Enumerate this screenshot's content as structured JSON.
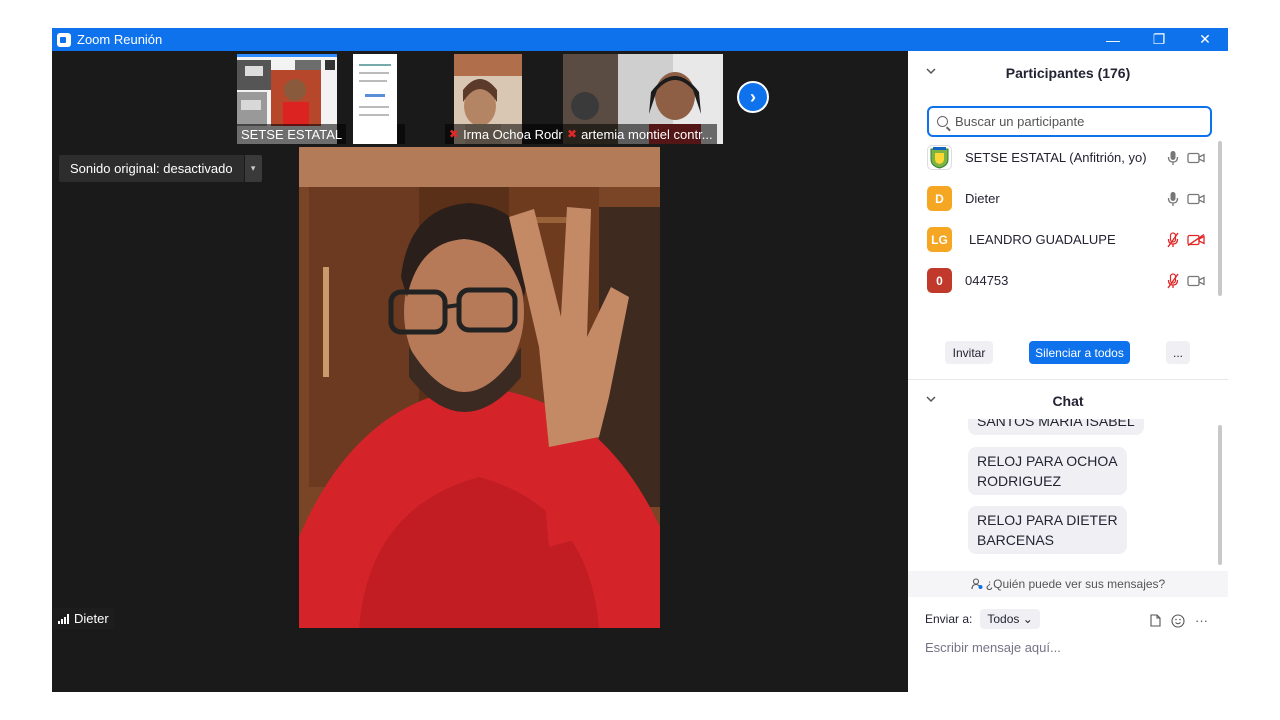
{
  "window": {
    "title": "Zoom Reunión",
    "controls": {
      "minimize": "—",
      "restore": "❐",
      "close": "✕"
    }
  },
  "video": {
    "thumbnails": [
      {
        "name": "SETSE ESTATAL",
        "muted": false
      },
      {
        "name": "",
        "muted": false
      },
      {
        "name": "Irma Ochoa Rodríguez",
        "muted": true
      },
      {
        "name": "artemia montiel contr...",
        "muted": true
      }
    ],
    "next_label": "›",
    "sound_label": "Sonido original: desactivado",
    "sound_caret": "▾",
    "active_speaker": "Dieter"
  },
  "participants": {
    "title": "Participantes (176)",
    "search_placeholder": "Buscar un participante",
    "list": [
      {
        "initials": "",
        "name": "SETSE ESTATAL (Anfitrión, yo)",
        "color": "#7cb342",
        "mic_muted": false,
        "cam_off": false
      },
      {
        "initials": "D",
        "name": "Dieter",
        "color": "#f5a623",
        "mic_muted": false,
        "cam_off": false
      },
      {
        "initials": "LG",
        "name": "LEANDRO GUADALUPE",
        "color": "#f5a623",
        "mic_muted": true,
        "cam_off": true
      },
      {
        "initials": "0",
        "name": "044753",
        "color": "#c0392b",
        "mic_muted": true,
        "cam_off": false
      }
    ],
    "invite": "Invitar",
    "mute_all": "Silenciar a todos",
    "more": "..."
  },
  "chat": {
    "title": "Chat",
    "messages": [
      "SANTOS MARIA ISABEL",
      "RELOJ PARA  OCHOA\nRODRIGUEZ",
      "RELOJ PARA DIETER\nBARCENAS"
    ],
    "who_can_see": "¿Quién puede ver sus mensajes?",
    "send_to_label": "Enviar a:",
    "send_to_value": "Todos",
    "input_placeholder": "Escribir mensaje aquí..."
  },
  "colors": {
    "accent": "#0e72ed",
    "muted": "#e02828"
  }
}
